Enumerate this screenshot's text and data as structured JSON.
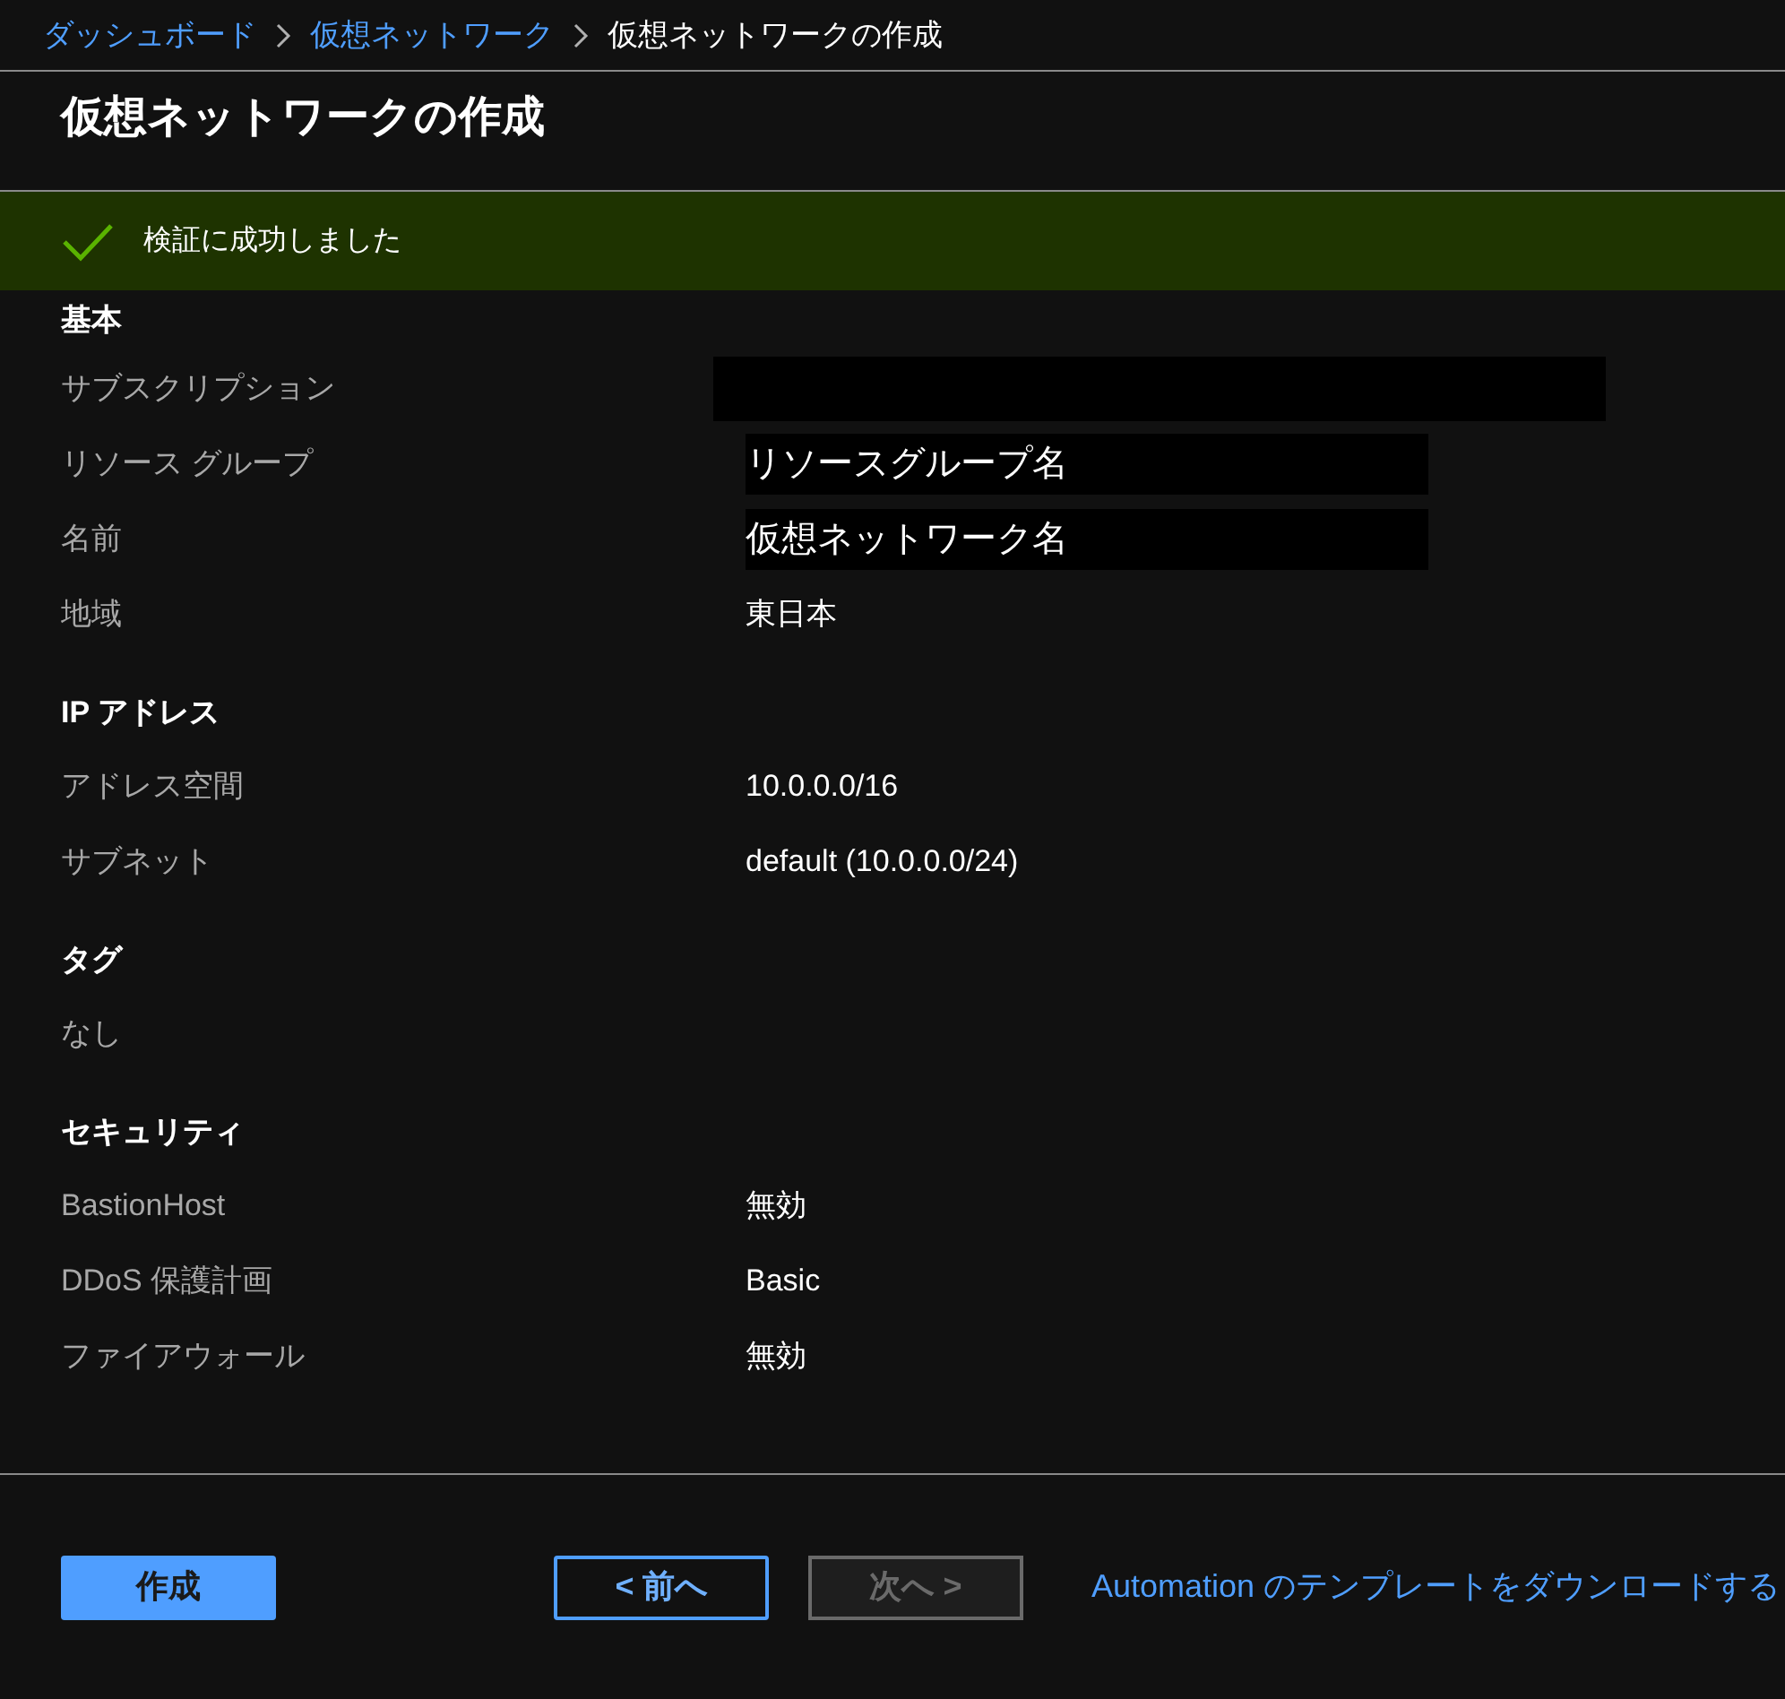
{
  "breadcrumb": [
    {
      "label": "ダッシュボード",
      "kind": "link"
    },
    {
      "label": "仮想ネットワーク",
      "kind": "link"
    },
    {
      "label": "仮想ネットワークの作成",
      "kind": "current"
    }
  ],
  "title": "仮想ネットワークの作成",
  "banner": {
    "message": "検証に成功しました"
  },
  "sections": [
    {
      "heading": "基本",
      "rows": [
        {
          "kind": "redacted",
          "label": "サブスクリプション"
        },
        {
          "kind": "masked",
          "label": "リソース グループ",
          "value": "リソースグループ名"
        },
        {
          "kind": "masked",
          "label": "名前",
          "value": "仮想ネットワーク名"
        },
        {
          "kind": "text",
          "label": "地域",
          "value": "東日本"
        }
      ]
    },
    {
      "heading": "IP アドレス",
      "rows": [
        {
          "kind": "text",
          "label": "アドレス空間",
          "value": "10.0.0.0/16"
        },
        {
          "kind": "text",
          "label": "サブネット",
          "value": "default (10.0.0.0/24)"
        }
      ]
    },
    {
      "heading": "タグ",
      "rows": [
        {
          "kind": "note",
          "label": "なし"
        }
      ]
    },
    {
      "heading": "セキュリティ",
      "rows": [
        {
          "kind": "text",
          "label": "BastionHost",
          "value": "無効"
        },
        {
          "kind": "text",
          "label": "DDoS 保護計画",
          "value": "Basic"
        },
        {
          "kind": "text",
          "label": "ファイアウォール",
          "value": "無効"
        }
      ]
    }
  ],
  "footer": {
    "buttons": [
      {
        "label": "作成",
        "kind": "primary",
        "disabled": false
      },
      {
        "label": "< 前へ",
        "kind": "secondary",
        "disabled": false
      },
      {
        "label": "次へ >",
        "kind": "secondary",
        "disabled": true
      }
    ],
    "link": "Automation のテンプレートをダウンロードする"
  }
}
